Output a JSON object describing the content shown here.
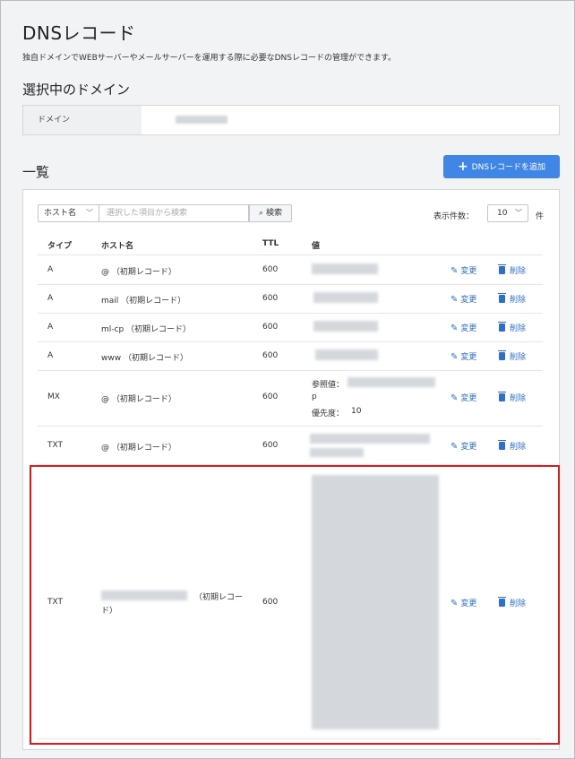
{
  "page": {
    "title": "DNSレコード",
    "description": "独自ドメインでWEBサーバーやメールサーバーを運用する際に必要なDNSレコードの管理ができます。"
  },
  "selected_domain": {
    "heading": "選択中のドメイン",
    "label": "ドメイン"
  },
  "list": {
    "heading": "一覧",
    "add_button": "DNSレコードを追加",
    "search": {
      "select_value": "ホスト名",
      "placeholder": "選択した項目から検索",
      "button": "検索"
    },
    "count_label": "表示件数：",
    "count_value": "10",
    "count_unit": "件",
    "columns": [
      "タイプ",
      "ホスト名",
      "TTL",
      "値"
    ],
    "edit_label": "変更",
    "delete_label": "削除",
    "rows": [
      {
        "type": "A",
        "host": "@ （初期レコード）",
        "ttl": "600"
      },
      {
        "type": "A",
        "host": "mail （初期レコード）",
        "ttl": "600"
      },
      {
        "type": "A",
        "host": "ml-cp （初期レコード）",
        "ttl": "600"
      },
      {
        "type": "A",
        "host": "www （初期レコード）",
        "ttl": "600"
      },
      {
        "type": "MX",
        "host": "@ （初期レコード）",
        "ttl": "600",
        "ref_label": "参照値：",
        "ref_tail": "p",
        "priority_label": "優先度：",
        "priority": "10"
      },
      {
        "type": "TXT",
        "host": "@ （初期レコード）",
        "ttl": "600"
      },
      {
        "type": "TXT",
        "host_suffix": "（初期レコー",
        "host_tail": "ド）",
        "ttl": "600"
      }
    ]
  }
}
